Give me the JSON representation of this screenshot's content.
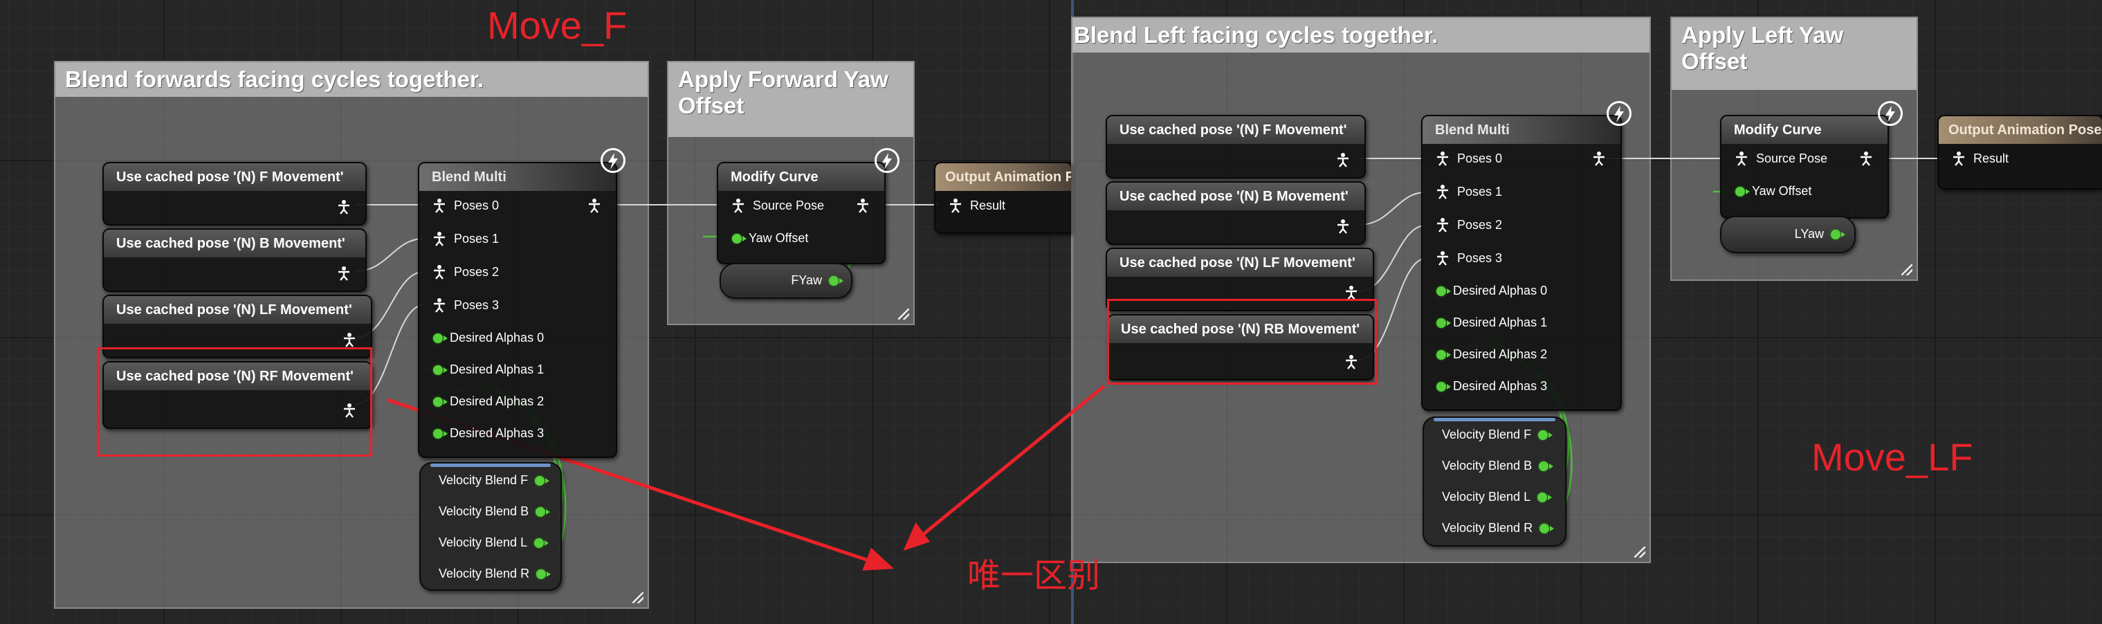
{
  "left_graph": {
    "label": "Move_F",
    "comment_blend": "Blend forwards facing cycles together.",
    "comment_yaw": "Apply Forward Yaw Offset",
    "cached_nodes": [
      {
        "title": "Use cached pose '(N) F Movement'"
      },
      {
        "title": "Use cached pose '(N) B Movement'"
      },
      {
        "title": "Use cached pose '(N) LF Movement'"
      },
      {
        "title": "Use cached pose '(N) RF Movement'"
      }
    ],
    "blend_multi": {
      "title": "Blend Multi",
      "pins": [
        "Poses 0",
        "Poses 1",
        "Poses 2",
        "Poses 3",
        "Desired Alphas 0",
        "Desired Alphas 1",
        "Desired Alphas 2",
        "Desired Alphas 3"
      ]
    },
    "velocity_node": {
      "pins": [
        "Velocity Blend F",
        "Velocity Blend B",
        "Velocity Blend L",
        "Velocity Blend R"
      ]
    },
    "modify_curve": {
      "title": "Modify Curve",
      "pins": [
        "Source Pose",
        "Yaw Offset"
      ]
    },
    "yaw_var": "FYaw",
    "output": {
      "title": "Output Animation Pose",
      "pin": "Result"
    }
  },
  "right_graph": {
    "label": "Move_LF",
    "comment_blend": "Blend Left facing cycles together.",
    "comment_yaw": "Apply Left Yaw Offset",
    "cached_nodes": [
      {
        "title": "Use cached pose '(N) F Movement'"
      },
      {
        "title": "Use cached pose '(N) B Movement'"
      },
      {
        "title": "Use cached pose '(N) LF Movement'"
      },
      {
        "title": "Use cached pose '(N) RB Movement'"
      }
    ],
    "blend_multi": {
      "title": "Blend Multi",
      "pins": [
        "Poses 0",
        "Poses 1",
        "Poses 2",
        "Poses 3",
        "Desired Alphas 0",
        "Desired Alphas 1",
        "Desired Alphas 2",
        "Desired Alphas 3"
      ]
    },
    "velocity_node": {
      "pins": [
        "Velocity Blend F",
        "Velocity Blend B",
        "Velocity Blend L",
        "Velocity Blend R"
      ]
    },
    "modify_curve": {
      "title": "Modify Curve",
      "pins": [
        "Source Pose",
        "Yaw Offset"
      ]
    },
    "yaw_var": "LYaw",
    "output": {
      "title": "Output Animation Pose",
      "pin": "Result"
    }
  },
  "annotation": {
    "difference_label": "唯一区别",
    "color": "#e8222a"
  },
  "colors": {
    "exec_wire": "#e0e0e0",
    "float_pin": "#55d03a",
    "velocity_accent": "#6d93c9"
  },
  "icons": {
    "pose_pin": "pose-icon",
    "fast_path": "lightning-bolt-icon"
  }
}
